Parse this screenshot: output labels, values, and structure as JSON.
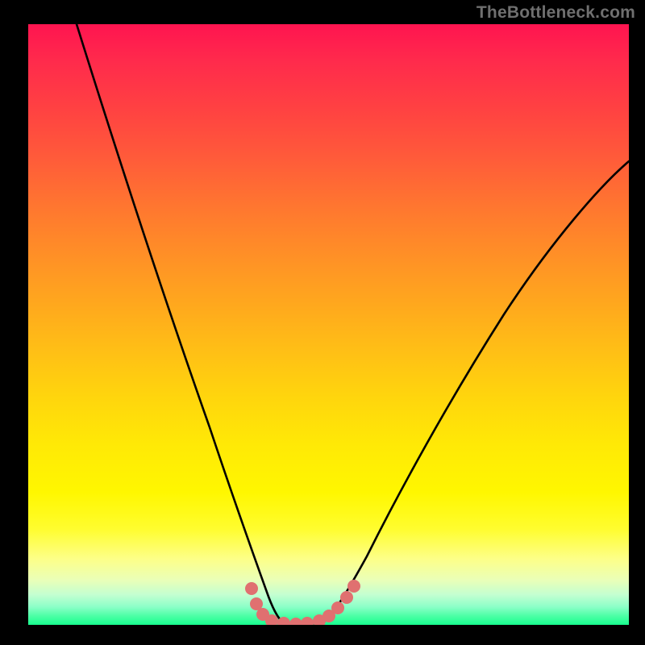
{
  "watermark": "TheBottleneck.com",
  "colors": {
    "background": "#000000",
    "curve_stroke": "#000000",
    "dot_fill": "#e07070",
    "watermark_text": "#6f6f6f"
  },
  "chart_data": {
    "type": "line",
    "title": "",
    "xlabel": "",
    "ylabel": "",
    "xlim": [
      0,
      100
    ],
    "ylim": [
      0,
      100
    ],
    "grid": false,
    "legend": false,
    "series": [
      {
        "name": "left-branch",
        "x": [
          8,
          12,
          16,
          20,
          24,
          27,
          30,
          33,
          35,
          37,
          38.5,
          40
        ],
        "values": [
          100,
          84,
          70,
          57,
          45,
          34,
          24,
          16,
          10,
          5.5,
          2.8,
          0.8
        ]
      },
      {
        "name": "right-branch",
        "x": [
          50,
          52,
          55,
          58,
          62,
          67,
          73,
          80,
          88,
          96,
          100
        ],
        "values": [
          0.8,
          2.5,
          6,
          11,
          18,
          27,
          37,
          48,
          60,
          71,
          77
        ]
      },
      {
        "name": "floor",
        "x": [
          40,
          42,
          44,
          46,
          48,
          50
        ],
        "values": [
          0.8,
          0.3,
          0.2,
          0.2,
          0.3,
          0.8
        ]
      }
    ],
    "dots": {
      "name": "marker-dots",
      "points": [
        {
          "x": 37.2,
          "y": 6.0
        },
        {
          "x": 38.0,
          "y": 3.5
        },
        {
          "x": 39.0,
          "y": 1.8
        },
        {
          "x": 40.5,
          "y": 0.6
        },
        {
          "x": 42.5,
          "y": 0.25
        },
        {
          "x": 44.5,
          "y": 0.2
        },
        {
          "x": 46.5,
          "y": 0.25
        },
        {
          "x": 48.5,
          "y": 0.6
        },
        {
          "x": 50.0,
          "y": 1.4
        },
        {
          "x": 51.5,
          "y": 2.8
        },
        {
          "x": 53.0,
          "y": 4.6
        },
        {
          "x": 54.2,
          "y": 6.5
        }
      ],
      "radius_data_units": 1.1
    },
    "gradient_stops": [
      {
        "pos": 0,
        "color": "#ff1450"
      },
      {
        "pos": 50,
        "color": "#ffa61e"
      },
      {
        "pos": 80,
        "color": "#fff700"
      },
      {
        "pos": 100,
        "color": "#18ff8f"
      }
    ]
  }
}
